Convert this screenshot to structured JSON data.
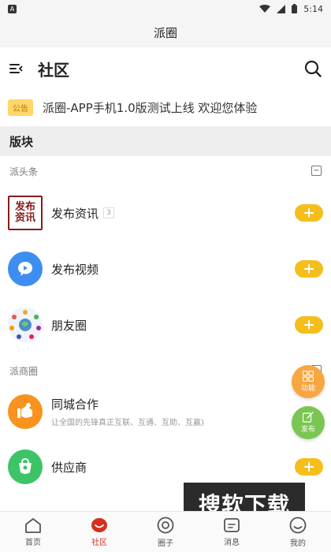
{
  "status_bar": {
    "notif": "A",
    "time": "5:14"
  },
  "window_title": "派圈",
  "header": {
    "title": "社区"
  },
  "notice": {
    "badge": "公告",
    "text": "派圈-APP手机1.0版测试上线 欢迎您体验"
  },
  "section": {
    "title": "版块"
  },
  "groups": [
    {
      "label": "派头条",
      "collapse_symbol": "−"
    },
    {
      "label": "派商圈",
      "collapse_symbol": "−"
    }
  ],
  "items": [
    {
      "title": "发布资讯",
      "count": "3",
      "icon_text": "发布资讯",
      "icon": "news-icon"
    },
    {
      "title": "发布视频",
      "icon": "video-icon"
    },
    {
      "title": "朋友圈",
      "icon": "friends-icon"
    },
    {
      "title": "同城合作",
      "subtitle": "让全国的先锋真正互联、互通、互助、互赢)",
      "icon": "cooperation-icon"
    },
    {
      "title": "供应商",
      "icon": "supplier-icon"
    }
  ],
  "fabs": [
    {
      "label": "功能",
      "icon": "grid-icon",
      "color": "#f7a640"
    },
    {
      "label": "发布",
      "icon": "edit-icon",
      "color": "#7bc651"
    }
  ],
  "watermark": "搜软下载",
  "tabs": [
    {
      "label": "首页",
      "icon": "home-icon",
      "active": false
    },
    {
      "label": "社区",
      "icon": "community-icon",
      "active": true
    },
    {
      "label": "圈子",
      "icon": "circle-icon",
      "active": false
    },
    {
      "label": "消息",
      "icon": "message-icon",
      "active": false
    },
    {
      "label": "我的",
      "icon": "profile-icon",
      "active": false
    }
  ],
  "colors": {
    "accent": "#f5be1a",
    "active_tab": "#d62f1f",
    "notice_badge": "#ffd66b"
  }
}
